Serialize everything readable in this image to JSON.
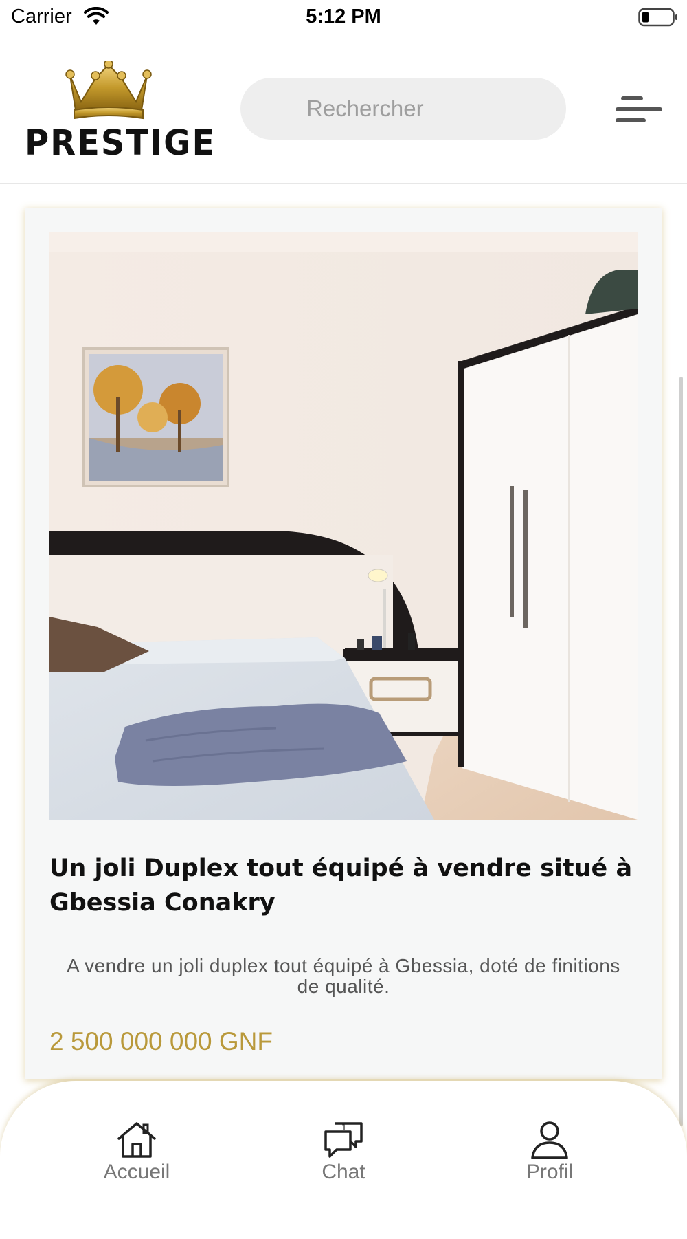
{
  "status_bar": {
    "carrier": "Carrier",
    "time": "5:12 PM",
    "icons": [
      "wifi-icon",
      "battery-icon"
    ]
  },
  "header": {
    "logo_text": "PRESTIGE",
    "search_placeholder": "Rechercher",
    "menu_icon": "hamburger-menu-icon"
  },
  "listing": {
    "title": "Un joli Duplex tout équipé à vendre situé à Gbessia Conakry",
    "description": "A vendre un joli duplex tout équipé à Gbessia, doté de finitions de qualité.",
    "price": "2 500 000 000 GNF"
  },
  "bottom_nav": {
    "items": [
      {
        "label": "Accueil",
        "icon": "home-icon"
      },
      {
        "label": "Chat",
        "icon": "chat-icon"
      },
      {
        "label": "Profil",
        "icon": "user-icon"
      }
    ]
  },
  "colors": {
    "accent_gold": "#b9993b",
    "card_bg": "#f6f7f7",
    "search_bg": "#eeeeee"
  }
}
